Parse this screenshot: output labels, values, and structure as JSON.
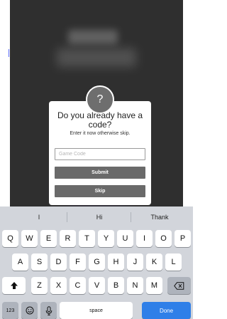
{
  "dialog": {
    "badge_glyph": "?",
    "title": "Do you already have a code?",
    "subtitle": "Enter it now otherwise skip.",
    "input_placeholder": "Game Code",
    "input_value": "",
    "submit_label": "Submit",
    "skip_label": "Skip"
  },
  "keyboard": {
    "suggestions": [
      "I",
      "Hi",
      "Thank"
    ],
    "rows": [
      [
        "Q",
        "W",
        "E",
        "R",
        "T",
        "Y",
        "U",
        "I",
        "O",
        "P"
      ],
      [
        "A",
        "S",
        "D",
        "F",
        "G",
        "H",
        "J",
        "K",
        "L"
      ],
      [
        "Z",
        "X",
        "C",
        "V",
        "B",
        "N",
        "M"
      ]
    ],
    "shift_icon": "shift-arrow-icon",
    "backspace_icon": "backspace-icon",
    "numbers_label": "123",
    "emoji_icon": "emoji-icon",
    "mic_icon": "microphone-icon",
    "space_label": "space",
    "done_label": "Done",
    "done_color": "#2f7fe8"
  }
}
